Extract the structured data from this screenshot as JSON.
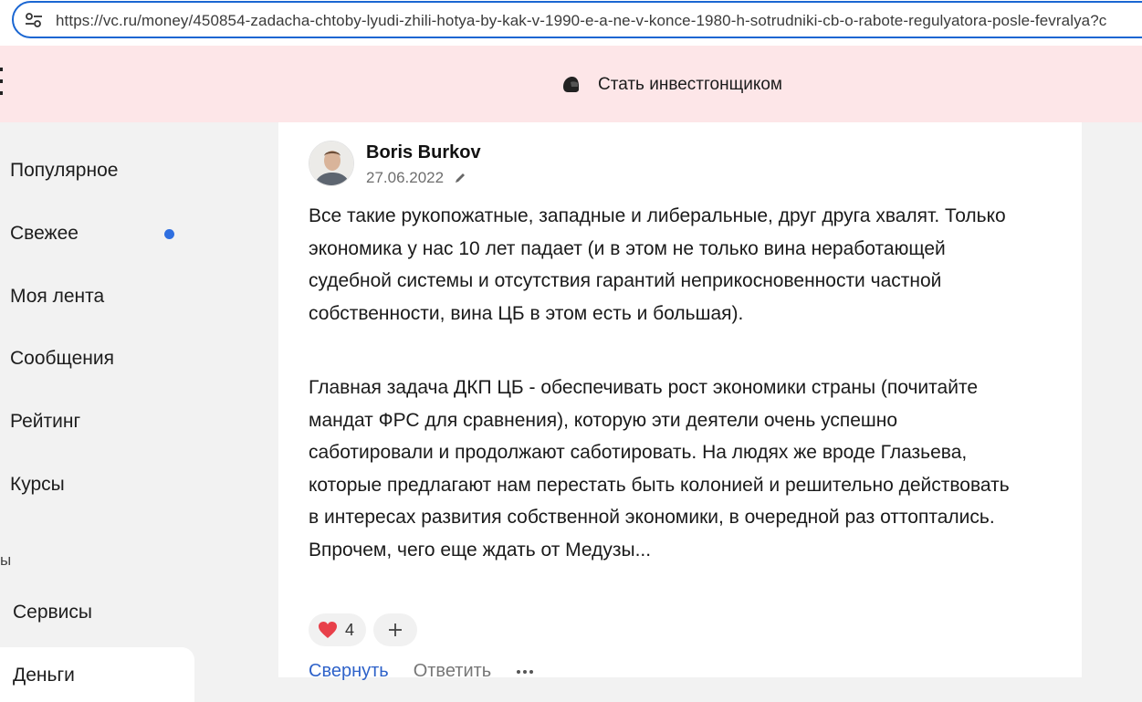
{
  "browser": {
    "url": "https://vc.ru/money/450854-zadacha-chtoby-lyudi-zhili-hotya-by-kak-v-1990-e-a-ne-v-konce-1980-h-sotrudniki-cb-o-rabote-regulyatora-posle-fevralya?c",
    "site_info_icon": "tune-icon"
  },
  "banner": {
    "promo_label": "Стать инвестгонщиком",
    "promo_icon": "helmet-icon",
    "background": "#fde6e8"
  },
  "sidebar": {
    "items": [
      {
        "label": "Популярное"
      },
      {
        "label": "Свежее",
        "has_unread_dot": true
      },
      {
        "label": "Моя лента"
      },
      {
        "label": "Сообщения"
      },
      {
        "label": "Рейтинг"
      },
      {
        "label": "Курсы"
      }
    ],
    "section_fragment": "ы",
    "services_label": "Сервисы",
    "active_item_label": "Деньги",
    "dot_color": "#2f6fe0"
  },
  "comment": {
    "author": "Boris Burkov",
    "date": "27.06.2022",
    "paragraphs": [
      "Все такие рукопожатные, западные и либеральные, друг друга хвалят. Только экономика у нас 10 лет падает (и в этом не только вина неработающей судебной системы и отсутствия гарантий неприкосновенности частной собственности, вина ЦБ в этом есть и большая).",
      "Главная задача ДКП ЦБ - обеспечивать рост экономики страны (почитайте мандат ФРС для сравнения), которую эти деятели очень успешно саботировали и продолжают саботировать. На людях же вроде Глазьева, которые предлагают нам перестать быть колонией и решительно действовать в интересах развития собственной экономики, в очередной раз оттоптались. Впрочем, чего еще ждать от Медузы..."
    ],
    "reactions": {
      "like_count": "4"
    },
    "actions": {
      "collapse": "Свернуть",
      "reply": "Ответить"
    },
    "link_color": "#2e62c9"
  }
}
